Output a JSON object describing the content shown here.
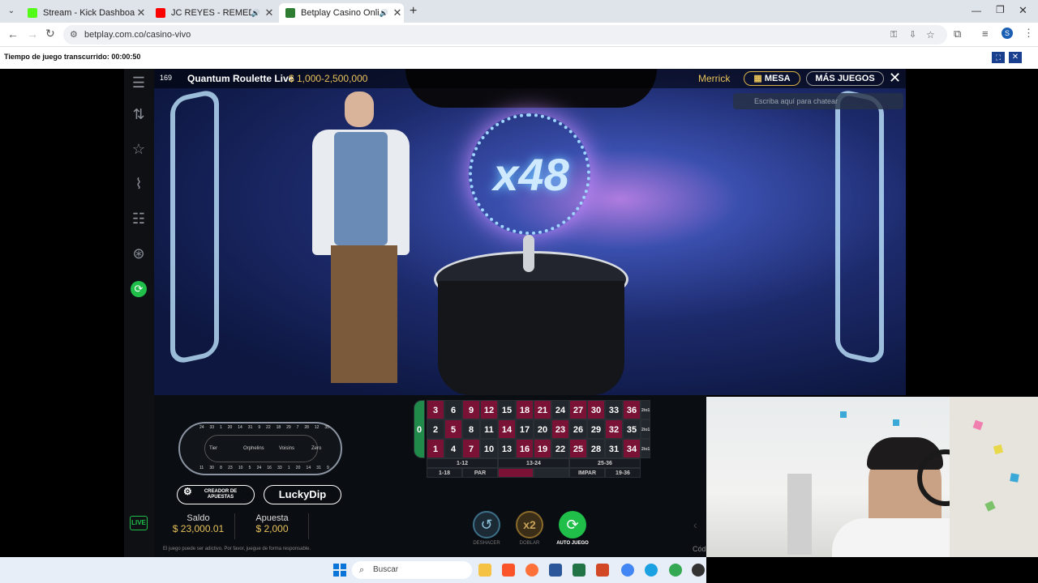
{
  "browser": {
    "tabs": [
      {
        "label": "Stream - Kick Dashboard",
        "color": "#53fc18"
      },
      {
        "label": "JC REYES - REMEDIO FT PIP",
        "color": "#ff0000"
      },
      {
        "label": "Betplay Casino Online en V",
        "color": "#2e7d32"
      }
    ],
    "new_tab": "+",
    "url": "betplay.com.co/casino-vivo",
    "profile_initial": "S"
  },
  "session": {
    "timer_text": "Tiempo de juego transcurrido: 00:00:50"
  },
  "game": {
    "players": "169",
    "title": "Quantum Roulette Live",
    "limits": "$ 1,000-2,500,000",
    "dealer": "Merrick",
    "mesa_label": "MESA",
    "mas_juegos_label": "MÁS JUEGOS",
    "chat_placeholder": "Escriba aquí para chatear",
    "multiplier": "x48",
    "racetrack": {
      "top": [
        "24",
        "33",
        "1",
        "20",
        "14",
        "31",
        "9",
        "22",
        "18",
        "29",
        "7",
        "28",
        "12",
        "35"
      ],
      "bottom": [
        "11",
        "30",
        "8",
        "23",
        "10",
        "5",
        "24",
        "16",
        "33",
        "1",
        "20",
        "14",
        "31",
        "9"
      ],
      "sections": [
        "Tier",
        "Orphelins",
        "Voisins",
        "Zero"
      ],
      "ends": [
        "10",
        "5",
        "3",
        "26"
      ]
    },
    "creador_label": "CREADOR DE APUESTAS",
    "luckydip_label": "LuckyDip",
    "saldo_label": "Saldo",
    "saldo_value": "$ 23,000.01",
    "apuesta_label": "Apuesta",
    "apuesta_value": "$ 2,000",
    "disclaimer": "El juego puede ser adictivo. Por favor, juegue de forma responsable.",
    "deshacer_label": "DESHACER",
    "doblar_label": "DOBLAR",
    "auto_label": "AUTO JUEGO",
    "doblar_icon_text": "x2",
    "live_label": "LIVE",
    "cod_label": "Cód",
    "table": {
      "rows": [
        [
          "3",
          "6",
          "9",
          "12",
          "15",
          "18",
          "21",
          "24",
          "27",
          "30",
          "33",
          "36"
        ],
        [
          "2",
          "5",
          "8",
          "11",
          "14",
          "17",
          "20",
          "23",
          "26",
          "29",
          "32",
          "35"
        ],
        [
          "1",
          "4",
          "7",
          "10",
          "13",
          "16",
          "19",
          "22",
          "25",
          "28",
          "31",
          "34"
        ]
      ],
      "reds": [
        "1",
        "3",
        "5",
        "7",
        "9",
        "12",
        "14",
        "16",
        "18",
        "19",
        "21",
        "23",
        "25",
        "27",
        "30",
        "32",
        "34",
        "36"
      ],
      "zero": "0",
      "column_label": "2to1",
      "dozens": [
        "1-12",
        "13-24",
        "25-36"
      ],
      "outside": [
        "1-18",
        "PAR",
        "",
        "",
        "IMPAR",
        "19-36"
      ]
    }
  },
  "taskbar": {
    "search_placeholder": "Buscar"
  }
}
